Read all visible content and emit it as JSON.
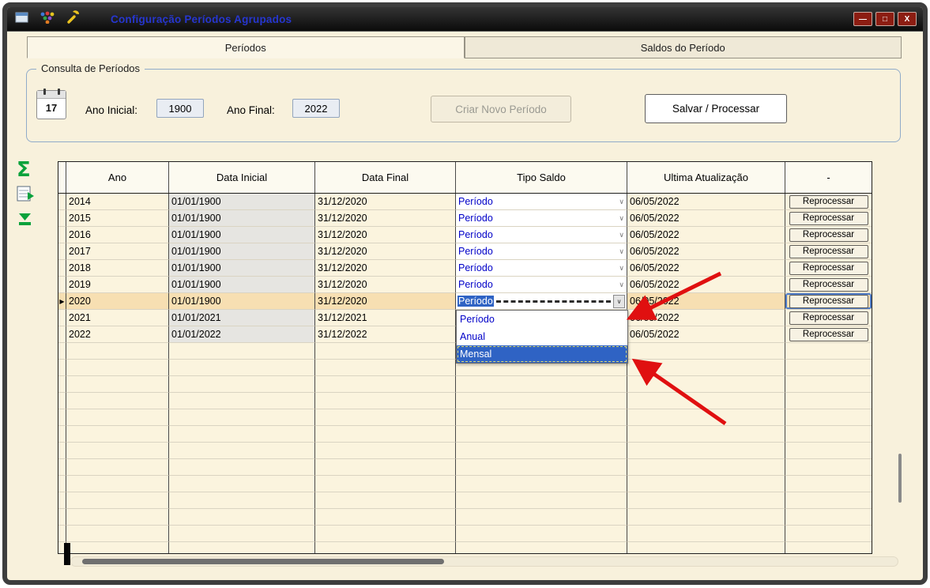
{
  "titlebar": {
    "title": "Configuração Períodos Agrupados",
    "minimize": "—",
    "maximize": "□",
    "close": "X"
  },
  "tabs": [
    {
      "label": "Períodos",
      "active": true
    },
    {
      "label": "Saldos do Período",
      "active": false
    }
  ],
  "consulta": {
    "legend": "Consulta de Períodos",
    "calendar_day": "17",
    "ano_inicial_label": "Ano Inicial:",
    "ano_inicial_value": "1900",
    "ano_final_label": "Ano Final:",
    "ano_final_value": "2022",
    "criar_novo_periodo_button": "Criar Novo Período",
    "salvar_processar_button": "Salvar / Processar"
  },
  "toolbar": {
    "sum_icon": "Σ"
  },
  "grid": {
    "columns": [
      "Ano",
      "Data Inicial",
      "Data Final",
      "Tipo Saldo",
      "Ultima Atualização",
      "-"
    ],
    "selected_marker": "▶",
    "chevron": "∨",
    "rows": [
      {
        "ano": "2014",
        "data_inicial": "01/01/1900",
        "data_final": "31/12/2020",
        "tipo_saldo": "Período",
        "ultima_atualizacao": "06/05/2022",
        "action": "Reprocessar",
        "selected": false,
        "editing": false
      },
      {
        "ano": "2015",
        "data_inicial": "01/01/1900",
        "data_final": "31/12/2020",
        "tipo_saldo": "Período",
        "ultima_atualizacao": "06/05/2022",
        "action": "Reprocessar",
        "selected": false,
        "editing": false
      },
      {
        "ano": "2016",
        "data_inicial": "01/01/1900",
        "data_final": "31/12/2020",
        "tipo_saldo": "Período",
        "ultima_atualizacao": "06/05/2022",
        "action": "Reprocessar",
        "selected": false,
        "editing": false
      },
      {
        "ano": "2017",
        "data_inicial": "01/01/1900",
        "data_final": "31/12/2020",
        "tipo_saldo": "Período",
        "ultima_atualizacao": "06/05/2022",
        "action": "Reprocessar",
        "selected": false,
        "editing": false
      },
      {
        "ano": "2018",
        "data_inicial": "01/01/1900",
        "data_final": "31/12/2020",
        "tipo_saldo": "Período",
        "ultima_atualizacao": "06/05/2022",
        "action": "Reprocessar",
        "selected": false,
        "editing": false
      },
      {
        "ano": "2019",
        "data_inicial": "01/01/1900",
        "data_final": "31/12/2020",
        "tipo_saldo": "Período",
        "ultima_atualizacao": "06/05/2022",
        "action": "Reprocessar",
        "selected": false,
        "editing": false
      },
      {
        "ano": "2020",
        "data_inicial": "01/01/1900",
        "data_final": "31/12/2020",
        "tipo_saldo": "Período",
        "ultima_atualizacao": "06/05/2022",
        "action": "Reprocessar",
        "selected": true,
        "editing": true
      },
      {
        "ano": "2021",
        "data_inicial": "01/01/2021",
        "data_final": "31/12/2021",
        "tipo_saldo": "",
        "ultima_atualizacao": "06/05/2022",
        "action": "Reprocessar",
        "selected": false,
        "editing": false
      },
      {
        "ano": "2022",
        "data_inicial": "01/01/2022",
        "data_final": "31/12/2022",
        "tipo_saldo": "",
        "ultima_atualizacao": "06/05/2022",
        "action": "Reprocessar",
        "selected": false,
        "editing": false
      }
    ],
    "empty_row_count": 13
  },
  "dropdown": {
    "options": [
      "Período",
      "Anual",
      "Mensal"
    ],
    "selected": "Mensal"
  },
  "colors": {
    "accent_blue": "#0000C8",
    "selected_row": "#F7DFB2",
    "highlight_blue": "#2F63C4",
    "arrow_red": "#E01010",
    "background_cream": "#F8F1DC"
  }
}
